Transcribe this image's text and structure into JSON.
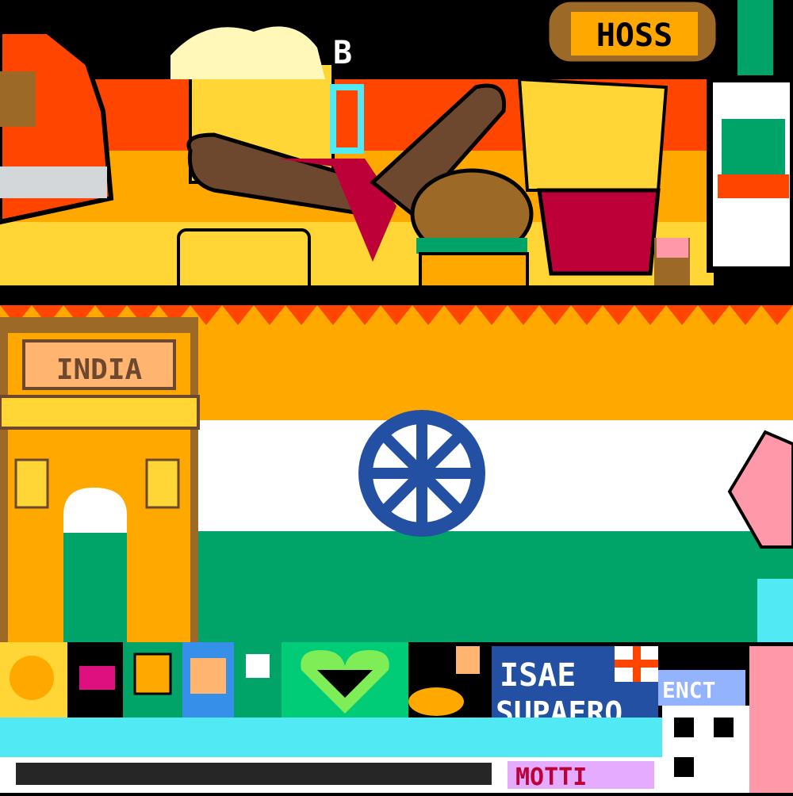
{
  "canvas": {
    "texts": {
      "gate_label": "INDIA",
      "badge_label": "HOSS",
      "tile_text_1": "ISAE",
      "tile_text_2": "SUPAERO",
      "tile_text_3": "ENCT",
      "bottom_text": "MOTTI",
      "top_letter": "B"
    }
  },
  "colors": {
    "saffron": "#FFA800",
    "white": "#FFFFFF",
    "green": "#00A368",
    "navy": "#2450A4",
    "brown": "#6D482F",
    "orange_red": "#FF4500",
    "gold": "#FFD635",
    "black": "#000000",
    "cyan": "#51E9F4",
    "pink": "#FF99AA",
    "dark_red": "#BE0039"
  }
}
